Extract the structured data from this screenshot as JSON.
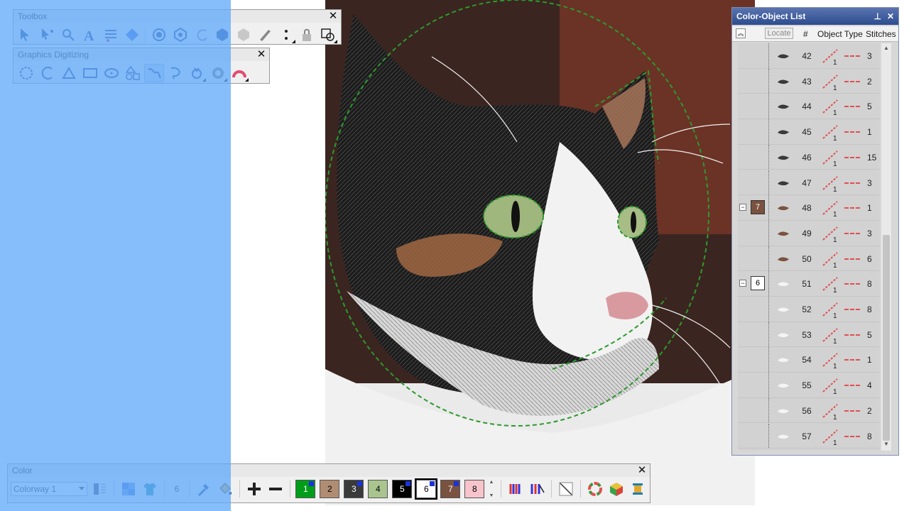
{
  "toolbox": {
    "title": "Toolbox",
    "tools": [
      "select-object-icon",
      "reshape-object-icon",
      "stitch-edit-icon",
      "lettering-icon",
      "monogramming-icon",
      "appliqué-icon",
      "fill-stitch-icon",
      "outline-stitch-icon",
      "curve-stitch-icon",
      "hexagon-fill-icon",
      "hexagon-outline-icon",
      "knife-icon",
      "dots-icon",
      "lock-icon",
      "group-icon"
    ]
  },
  "graphics": {
    "title": "Graphics Digitizing",
    "tools": [
      "digitize-closed-shape-icon",
      "digitize-open-shape-icon",
      "shape-nodes-icon",
      "rectangle-icon",
      "ellipse-icon",
      "shapes-icon",
      "freehand-open-icon",
      "freehand-closed-icon",
      "auto-digitize-icon",
      "photo-stitch-icon",
      "color-photo-stitch-icon"
    ]
  },
  "color_object_list": {
    "title": "Color-Object List",
    "locate_label": "Locate",
    "columns": {
      "num": "#",
      "type": "Object Type",
      "stitches": "Stitches"
    },
    "rows": [
      {
        "num": "42",
        "stitches": "3",
        "badge": null
      },
      {
        "num": "43",
        "stitches": "2",
        "badge": null
      },
      {
        "num": "44",
        "stitches": "5",
        "badge": null
      },
      {
        "num": "45",
        "stitches": "1",
        "badge": null
      },
      {
        "num": "46",
        "stitches": "15",
        "badge": null
      },
      {
        "num": "47",
        "stitches": "3",
        "badge": null
      },
      {
        "num": "48",
        "stitches": "1",
        "badge": "7",
        "badge_color": "#7a5240",
        "badge_text_color": "#ffffff"
      },
      {
        "num": "49",
        "stitches": "3",
        "badge": null
      },
      {
        "num": "50",
        "stitches": "6",
        "badge": null
      },
      {
        "num": "51",
        "stitches": "8",
        "badge": "6",
        "badge_color": "#ffffff",
        "badge_text_color": "#000000"
      },
      {
        "num": "52",
        "stitches": "8",
        "badge": null
      },
      {
        "num": "53",
        "stitches": "5",
        "badge": null
      },
      {
        "num": "54",
        "stitches": "1",
        "badge": null
      },
      {
        "num": "55",
        "stitches": "4",
        "badge": null
      },
      {
        "num": "56",
        "stitches": "2",
        "badge": null
      },
      {
        "num": "57",
        "stitches": "8",
        "badge": null
      }
    ]
  },
  "color_bar": {
    "title": "Color",
    "colorway": "Colorway 1",
    "thread_count": "6",
    "swatches": [
      {
        "label": "1",
        "bg": "#009d1a",
        "fg": "#ffffff",
        "mark": true,
        "selected": false
      },
      {
        "label": "2",
        "bg": "#b08d72",
        "fg": "#000000",
        "mark": false,
        "selected": false
      },
      {
        "label": "3",
        "bg": "#3a3a3a",
        "fg": "#ffffff",
        "mark": true,
        "selected": false
      },
      {
        "label": "4",
        "bg": "#a9c48e",
        "fg": "#000000",
        "mark": false,
        "selected": false
      },
      {
        "label": "5",
        "bg": "#000000",
        "fg": "#ffffff",
        "mark": true,
        "selected": false
      },
      {
        "label": "6",
        "bg": "#ffffff",
        "fg": "#000000",
        "mark": true,
        "selected": true
      },
      {
        "label": "7",
        "bg": "#7a5240",
        "fg": "#ffffff",
        "mark": true,
        "selected": false
      },
      {
        "label": "8",
        "bg": "#f7c4cc",
        "fg": "#000000",
        "mark": false,
        "selected": false
      }
    ]
  },
  "colors": {
    "highlight": "#64aafa",
    "title_bar": "#2c4c8f",
    "outline_guide": "#2d9a2d"
  }
}
